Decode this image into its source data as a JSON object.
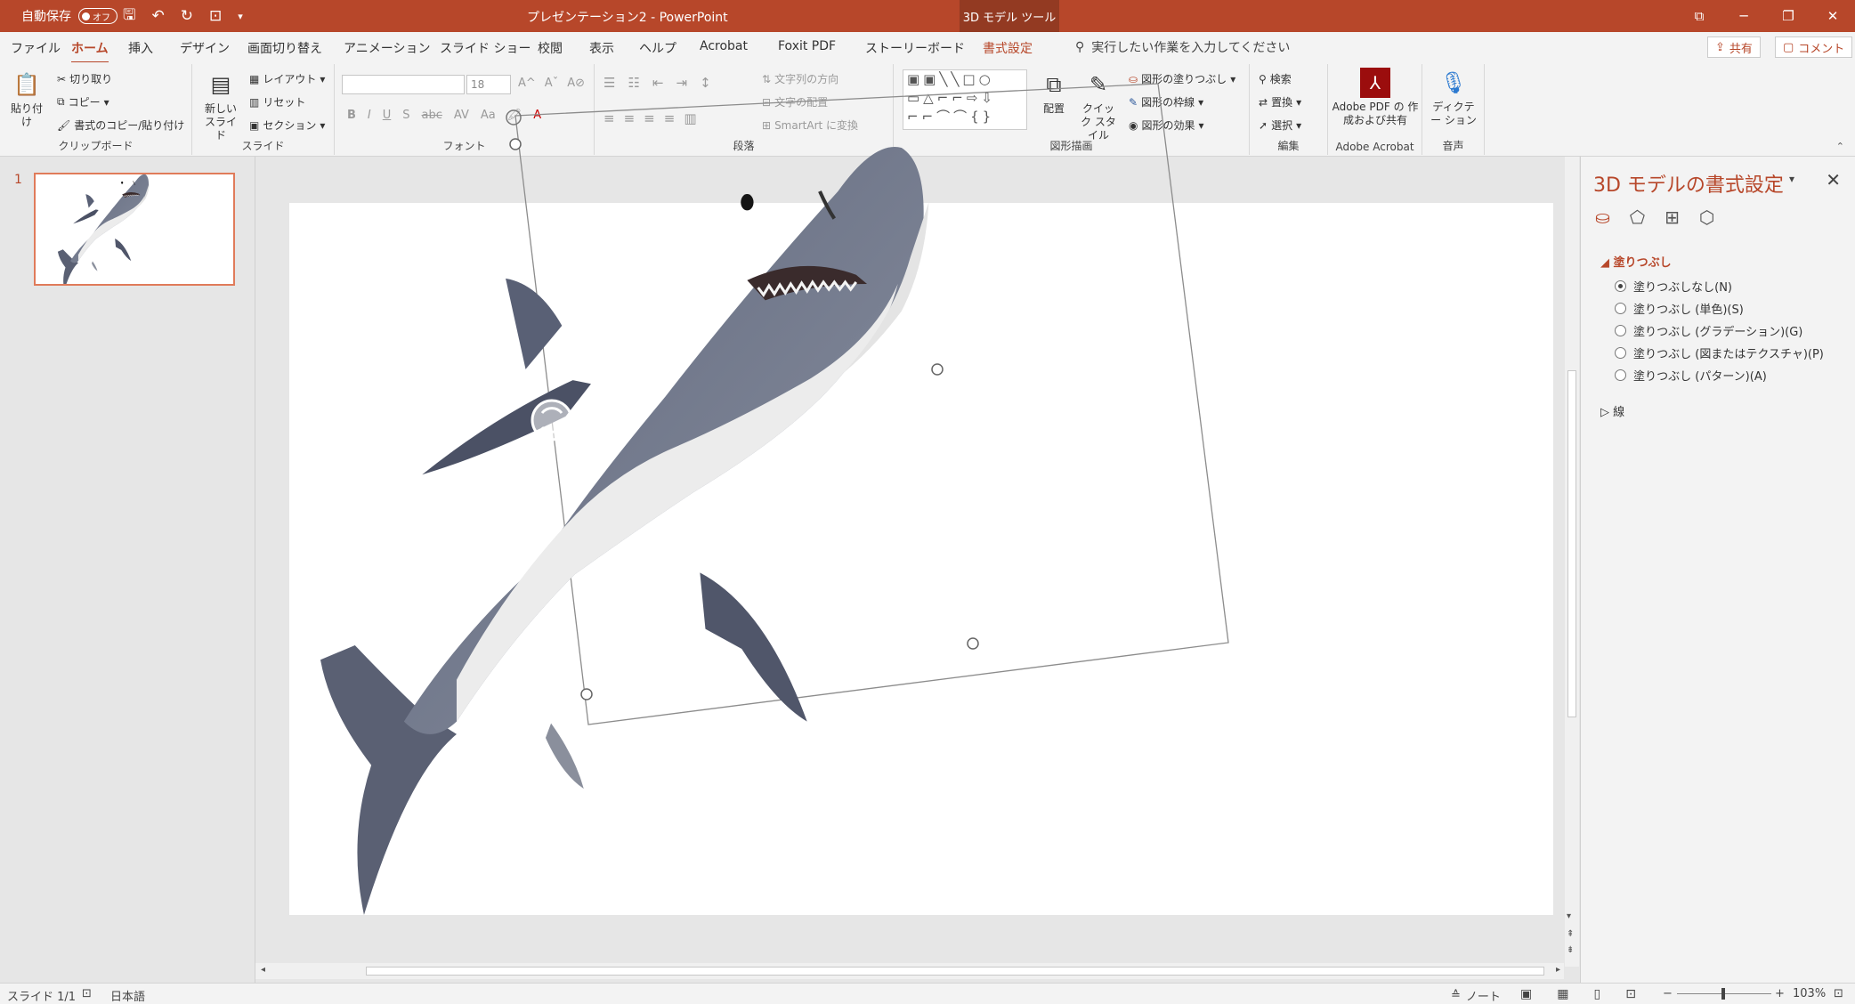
{
  "titlebar": {
    "autosave_label": "自動保存",
    "autosave_state": "オフ",
    "doc_title": "プレゼンテーション2  -  PowerPoint",
    "context_tab": "3D モデル ツール",
    "window_buttons": [
      "⧉",
      "─",
      "❐",
      "✕"
    ]
  },
  "tabs": [
    "ファイル",
    "ホーム",
    "挿入",
    "デザイン",
    "画面切り替え",
    "アニメーション",
    "スライド ショー",
    "校閲",
    "表示",
    "ヘルプ",
    "Acrobat",
    "Foxit PDF",
    "ストーリーボード",
    "書式設定"
  ],
  "active_tab": "ホーム",
  "tellme": "実行したい作業を入力してください",
  "share_label": "共有",
  "comment_label": "コメント",
  "ribbon": {
    "clipboard": {
      "label": "クリップボード",
      "paste": "貼り付け",
      "cut": "切り取り",
      "copy": "コピー",
      "format_painter": "書式のコピー/貼り付け"
    },
    "slides": {
      "label": "スライド",
      "new_slide": "新しい スライド",
      "layout": "レイアウト",
      "reset": "リセット",
      "section": "セクション"
    },
    "font": {
      "label": "フォント",
      "size": "18",
      "bold": "B",
      "italic": "I",
      "underline": "U",
      "shadow": "S",
      "strike": "abc",
      "spacing": "AV",
      "case": "Aa"
    },
    "paragraph": {
      "label": "段落",
      "text_direction": "文字列の方向",
      "align_text": "文字の配置",
      "smartart": "SmartArt に変換"
    },
    "drawing": {
      "label": "図形描画",
      "arrange": "配置",
      "quick_styles": "クイック スタイル",
      "shape_fill": "図形の塗りつぶし",
      "shape_outline": "図形の枠線",
      "shape_effects": "図形の効果"
    },
    "editing": {
      "label": "編集",
      "find": "検索",
      "replace": "置換",
      "select": "選択"
    },
    "acrobat": {
      "label": "Adobe Acrobat",
      "create": "Adobe PDF の 作成および共有"
    },
    "voice": {
      "label": "音声",
      "dictate": "ディクテー ション"
    }
  },
  "thumbnail": {
    "number": "1"
  },
  "pane": {
    "title": "3D モデルの書式設定",
    "fill_header": "塗りつぶし",
    "fill_options": [
      "塗りつぶしなし(N)",
      "塗りつぶし (単色)(S)",
      "塗りつぶし (グラデーション)(G)",
      "塗りつぶし (図またはテクスチャ)(P)",
      "塗りつぶし (パターン)(A)"
    ],
    "selected_fill": 0,
    "line_header": "線"
  },
  "status": {
    "slide": "スライド 1/1",
    "language": "日本語",
    "notes": "ノート",
    "zoom": "103%"
  },
  "colors": {
    "accent": "#b7472a",
    "context": "#933a22",
    "shark_top": "#6c7488",
    "shark_belly": "#eeeeee"
  }
}
